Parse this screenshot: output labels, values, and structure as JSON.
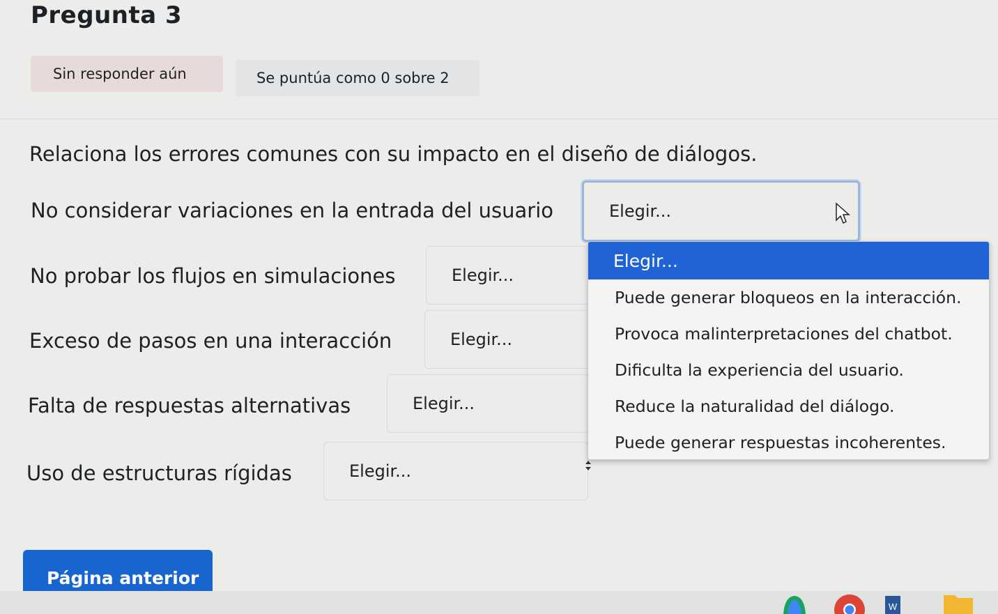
{
  "question": {
    "title": "Pregunta 3",
    "state": "Sin responder aún",
    "grade": "Se puntúa como 0 sobre 2",
    "prompt": "Relaciona los errores comunes con su impacto en el diseño de diálogos."
  },
  "rows": [
    {
      "label": "No considerar variaciones en la entrada del usuario",
      "value": "Elegir..."
    },
    {
      "label": "No probar los flujos en simulaciones",
      "value": "Elegir..."
    },
    {
      "label": "Exceso de pasos en una interacción",
      "value": "Elegir..."
    },
    {
      "label": "Falta de respuestas alternativas",
      "value": "Elegir..."
    },
    {
      "label": "Uso de estructuras rígidas",
      "value": "Elegir..."
    }
  ],
  "dropdown": {
    "options": [
      "Elegir...",
      "Puede generar bloqueos en la interacción.",
      "Provoca malinterpretaciones del chatbot.",
      "Dificulta la experiencia del usuario.",
      "Reduce la naturalidad del diálogo.",
      "Puede generar respuestas incoherentes."
    ],
    "selected_index": 0
  },
  "nav": {
    "prev_label": "Página anterior"
  },
  "colors": {
    "accent": "#1f63d6",
    "button": "#1865cf",
    "state_badge": "#e9dada",
    "grade_badge": "#e2e4e6"
  },
  "taskbar": {
    "icons": [
      "maps-icon",
      "chrome-icon",
      "word-icon",
      "folder-icon"
    ],
    "word_letter": "W"
  }
}
